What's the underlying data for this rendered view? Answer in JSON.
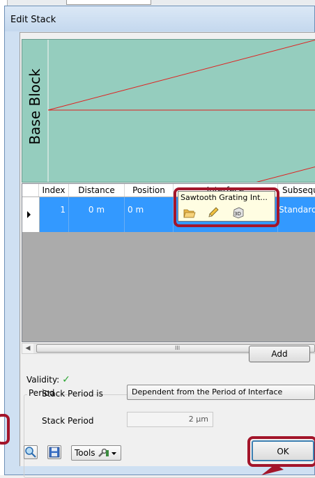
{
  "window": {
    "title": "Edit Stack"
  },
  "preview": {
    "label": "Base Block"
  },
  "grid": {
    "columns": [
      "Index",
      "Distance",
      "Position",
      "Interface",
      "Subsequ"
    ],
    "row": {
      "index": "1",
      "distance": "0 m",
      "position": "0 m",
      "interface": "Sawtooth Grating Int...",
      "subsequent": "Standard"
    }
  },
  "scrollbar": {
    "grip": "III"
  },
  "validity": {
    "label": "Validity:",
    "status": "✓"
  },
  "add_label": "Add",
  "period": {
    "group_title": "Period",
    "stack_period_is_label": "Stack Period is",
    "stack_period_is_value": "Dependent from the Period of Interface",
    "stack_period_label": "Stack Period",
    "stack_period_value": "2 µm"
  },
  "toolbar": {
    "tools_label": "Tools"
  },
  "ok_label": "OK",
  "colors": {
    "highlight": "#a3152a",
    "selection": "#3399ff",
    "preview_bg": "#95cdbe"
  }
}
